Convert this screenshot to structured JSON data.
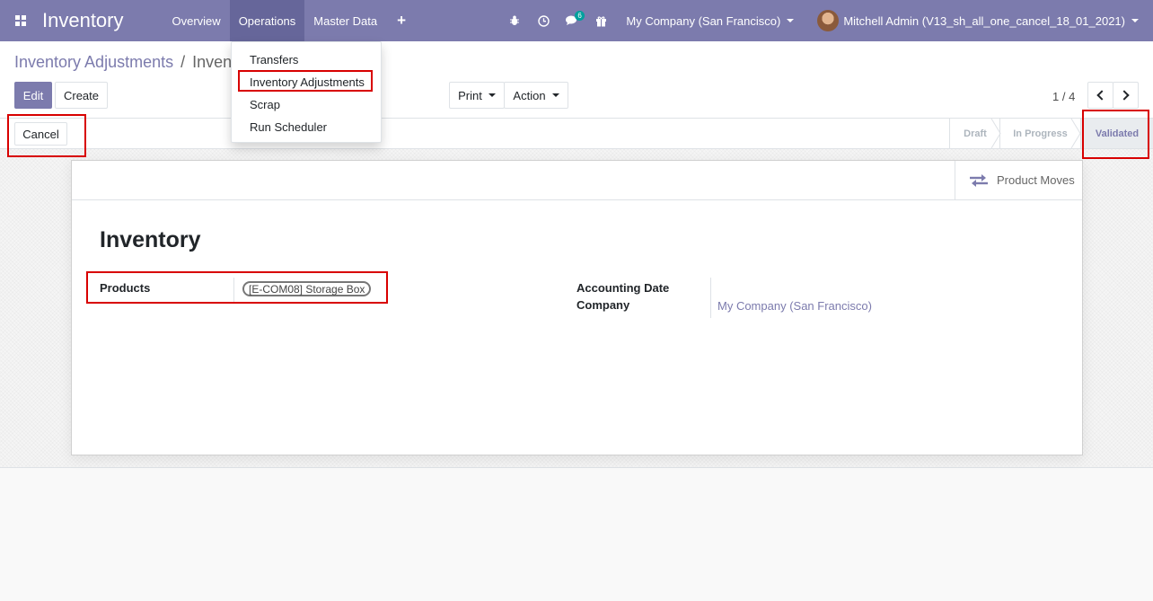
{
  "navbar": {
    "app_title": "Inventory",
    "menu": [
      "Overview",
      "Operations",
      "Master Data"
    ],
    "plus": "+",
    "chat_badge": "6",
    "company": "My Company (San Francisco)",
    "user": "Mitchell Admin (V13_sh_all_one_cancel_18_01_2021)"
  },
  "breadcrumb": {
    "parent": "Inventory Adjustments",
    "separator": "/",
    "current": "Invent"
  },
  "buttons": {
    "edit": "Edit",
    "create": "Create",
    "print": "Print",
    "action": "Action",
    "cancel": "Cancel"
  },
  "pager": {
    "value": "1 / 4"
  },
  "stages": [
    "Draft",
    "In Progress",
    "Validated"
  ],
  "active_stage": "Validated",
  "dropdown": {
    "items": [
      "Transfers",
      "Inventory Adjustments",
      "Scrap",
      "Run Scheduler"
    ]
  },
  "form": {
    "smart_button": "Product Moves",
    "title": "Inventory",
    "products_label": "Products",
    "products_tag": "[E-COM08] Storage Box",
    "accounting_date_label": "Accounting Date",
    "company_label": "Company",
    "company_value": "My Company (San Francisco)"
  },
  "colors": {
    "brand": "#7c7bad",
    "annotation": "#d80000",
    "badge": "#00a09d"
  }
}
